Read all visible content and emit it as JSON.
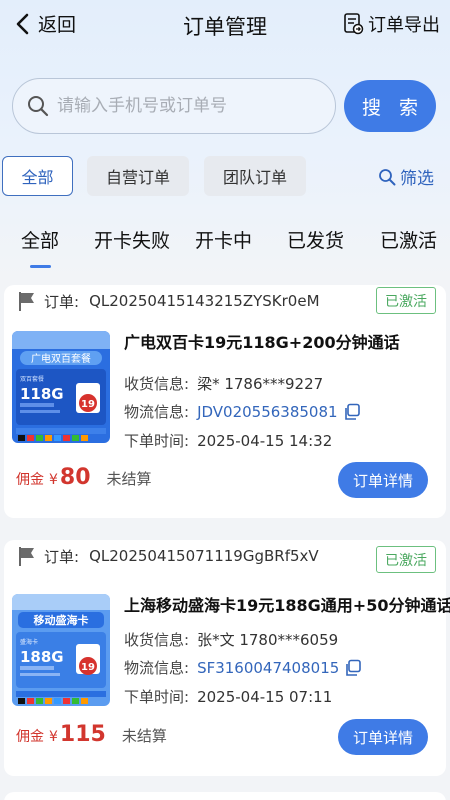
{
  "header": {
    "back_label": "返回",
    "title": "订单管理",
    "export_label": "订单导出"
  },
  "search": {
    "placeholder": "请输入手机号或订单号",
    "button_label": "搜 索"
  },
  "filters": {
    "chips": [
      "全部",
      "自营订单",
      "团队订单"
    ],
    "active": "全部",
    "screen_label": "筛选"
  },
  "tabs": {
    "items": [
      "全部",
      "开卡失败",
      "开卡中",
      "已发货",
      "已激活"
    ],
    "active": "全部"
  },
  "orders": [
    {
      "order_label": "订单:",
      "order_no": "QL20250415143215ZYSKr0eM",
      "status": "已激活",
      "product_name": "广电双百卡19元118G+200分钟通话",
      "receiver_label": "收货信息:",
      "receiver": "梁*  1786***9227",
      "logistics_label": "物流信息:",
      "logistics_no": "JDV020556385081",
      "time_label": "下单时间:",
      "order_time": "2025-04-15 14:32",
      "commission_label": "佣金",
      "currency": "¥",
      "commission": "80",
      "settle_status": "未结算",
      "detail_label": "订单详情",
      "thumb": {
        "banner": "广电双百套餐",
        "data": "118G",
        "price": "19",
        "sub": "双百套餐"
      }
    },
    {
      "order_label": "订单:",
      "order_no": "QL20250415071119GgBRf5xV",
      "status": "已激活",
      "product_name": "上海移动盛海卡19元188G通用+50分钟通话",
      "receiver_label": "收货信息:",
      "receiver": "张*文  1780***6059",
      "logistics_label": "物流信息:",
      "logistics_no": "SF3160047408015",
      "time_label": "下单时间:",
      "order_time": "2025-04-15 07:11",
      "commission_label": "佣金",
      "currency": "¥",
      "commission": "115",
      "settle_status": "未结算",
      "detail_label": "订单详情",
      "thumb": {
        "banner": "移动盛海卡",
        "data": "188G",
        "price": "19",
        "sub": "盛海卡"
      }
    }
  ],
  "colors": {
    "accent": "#3f7be6",
    "status_green": "#4aa85f",
    "price_red": "#d2362e",
    "link_blue": "#3366bb"
  }
}
